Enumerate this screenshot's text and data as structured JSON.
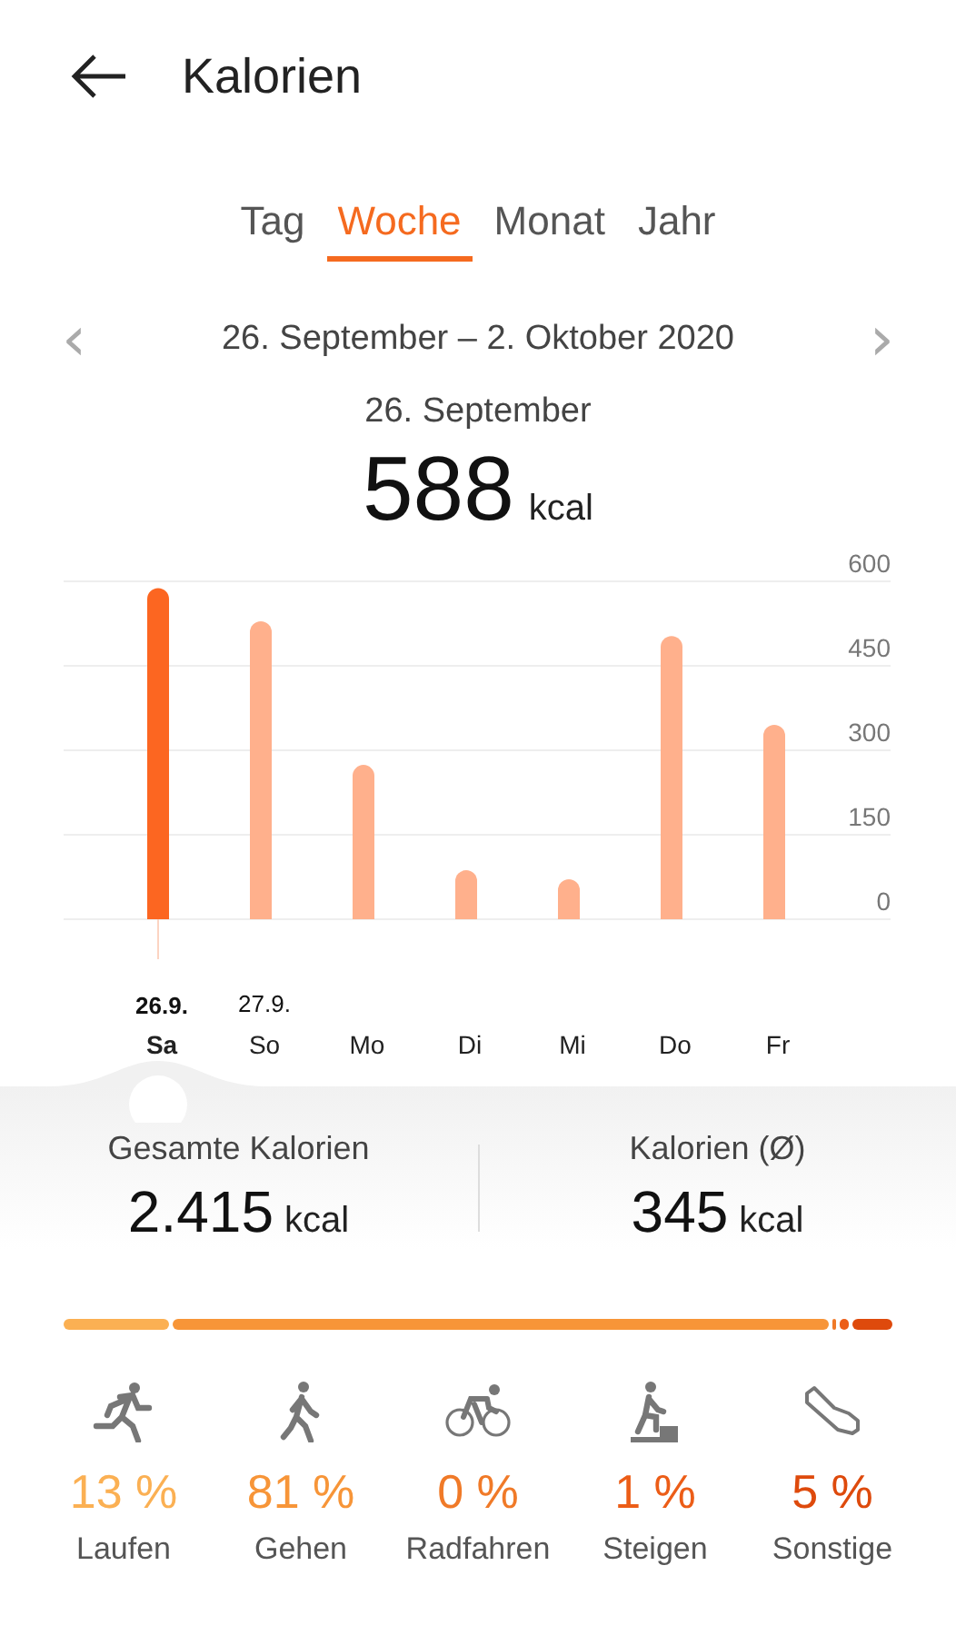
{
  "header": {
    "title": "Kalorien"
  },
  "tabs": [
    {
      "label": "Tag",
      "selected": false
    },
    {
      "label": "Woche",
      "selected": true
    },
    {
      "label": "Monat",
      "selected": false
    },
    {
      "label": "Jahr",
      "selected": false
    }
  ],
  "range": {
    "label": "26. September – 2. Oktober 2020",
    "prev_arrow": "‹",
    "next_arrow": "›"
  },
  "selection": {
    "date": "26. September",
    "value": "588",
    "unit": "kcal"
  },
  "chart": {
    "chart_data": {
      "type": "bar",
      "categories": [
        "Sa",
        "So",
        "Mo",
        "Di",
        "Mi",
        "Do",
        "Fr"
      ],
      "series": [
        {
          "color": "#fc6621",
          "values": [
            588,
            null,
            null,
            null,
            null,
            null,
            null
          ]
        },
        {
          "color": "#ffb08c",
          "values": [
            null,
            529,
            274,
            87,
            71,
            503,
            345
          ]
        }
      ],
      "stacked": true,
      "ylim": [
        0,
        600
      ],
      "yticks": [
        0,
        150,
        300,
        450,
        600
      ],
      "grid": true
    },
    "day_states": [
      {
        "selected": true,
        "date": "26.9."
      },
      {
        "selected": false,
        "date": "27.9."
      },
      {
        "selected": false
      },
      {
        "selected": false
      },
      {
        "selected": false
      },
      {
        "selected": false
      },
      {
        "selected": false
      }
    ]
  },
  "summary": [
    {
      "label": "Gesamte Kalorien",
      "value": "2.415",
      "unit": "kcal"
    },
    {
      "label": "Kalorien (Ø)",
      "value": "345",
      "unit": "kcal"
    }
  ],
  "breakdown_bar": [
    {
      "color": "#fbb053"
    },
    {
      "color": "#f79538"
    },
    {
      "color": "#f07a28"
    },
    {
      "color": "#ec5d17"
    },
    {
      "color": "#de4a0c"
    }
  ],
  "activities": [
    {
      "kind": "run",
      "percent": "13 %",
      "label": "Laufen",
      "color": "#fbb053"
    },
    {
      "kind": "walk",
      "percent": "81 %",
      "label": "Gehen",
      "color": "#f79538"
    },
    {
      "kind": "bike",
      "percent": "0 %",
      "label": "Radfahren",
      "color": "#f07a28"
    },
    {
      "kind": "climb",
      "percent": "1 %",
      "label": "Steigen",
      "color": "#ec5d17"
    },
    {
      "kind": "other",
      "percent": "5 %",
      "label": "Sonstige",
      "color": "#de4a0c"
    }
  ]
}
